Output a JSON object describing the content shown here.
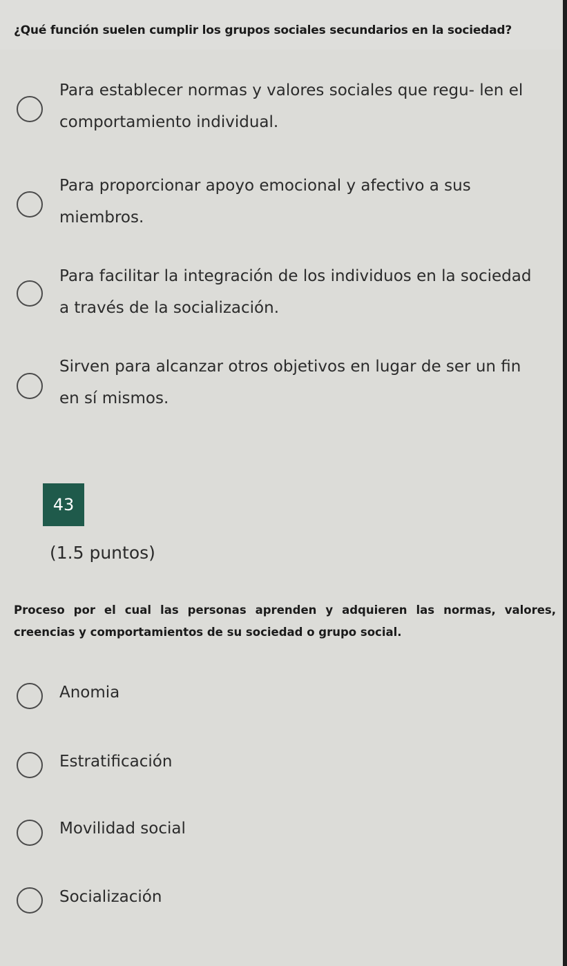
{
  "question1": {
    "text": "¿Qué función suelen cumplir los grupos sociales secundarios en la sociedad?",
    "options": [
      {
        "label": "Para establecer normas y valores sociales que regu- len el comportamiento individual."
      },
      {
        "label": "Para proporcionar apoyo emocional y afectivo a sus miembros."
      },
      {
        "label": "Para facilitar la integración de los individuos en la sociedad a través de la socialización."
      },
      {
        "label": "Sirven para alcanzar otros objetivos en lugar de ser un fin en sí mismos."
      }
    ]
  },
  "question2": {
    "number": "43",
    "points": "(1.5 puntos)",
    "text": "Proceso por el cual las personas aprenden y adquieren las normas, valores, creencias y comportamientos de su sociedad o grupo social.",
    "options": [
      {
        "label": "Anomia"
      },
      {
        "label": "Estratificación"
      },
      {
        "label": "Movilidad social"
      },
      {
        "label": "Socialización"
      }
    ]
  },
  "colors": {
    "badge_bg": "#1f5a4b",
    "page_bg": "#dcdcd8"
  }
}
